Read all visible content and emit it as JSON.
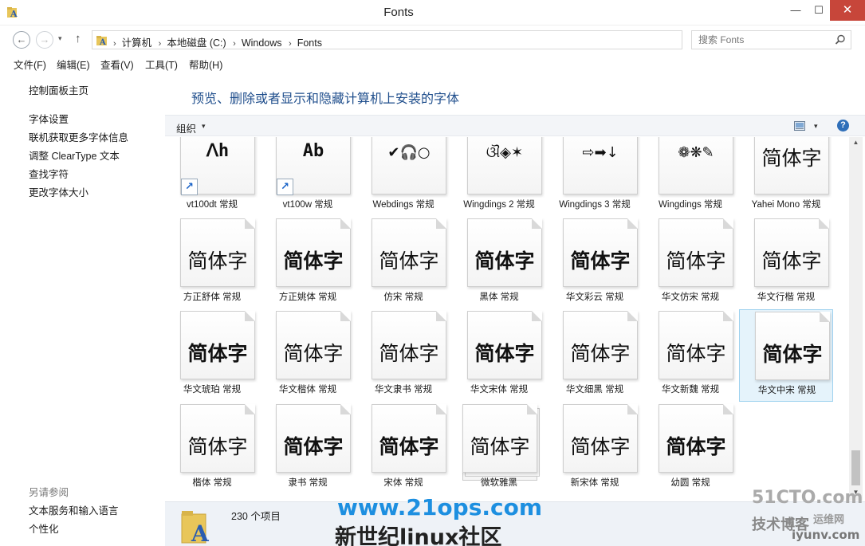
{
  "window": {
    "title": "Fonts",
    "min": "—",
    "max": "☐",
    "close": "✕"
  },
  "nav": {
    "back": "←",
    "forward": "→",
    "up": "↑",
    "dropdown": "▾"
  },
  "address": {
    "crumbs": [
      "计算机",
      "本地磁盘 (C:)",
      "Windows",
      "Fonts"
    ],
    "separator": "›",
    "refresh": "↻",
    "dropdown": "▾"
  },
  "search": {
    "placeholder": "搜索 Fonts",
    "icon": "search-icon"
  },
  "menu": [
    "文件(F)",
    "编辑(E)",
    "查看(V)",
    "工具(T)",
    "帮助(H)"
  ],
  "sidebar": {
    "home": "控制面板主页",
    "links": [
      "字体设置",
      "联机获取更多字体信息",
      "调整 ClearType 文本",
      "查找字符",
      "更改字体大小"
    ],
    "see_also_title": "另请参阅",
    "see_also": [
      "文本服务和输入语言",
      "个性化"
    ]
  },
  "main": {
    "heading": "预览、删除或者显示和隐藏计算机上安装的字体",
    "organize": "组织",
    "dropdown": "▾",
    "help": "?",
    "view_icon": "change-view-icon"
  },
  "fonts": [
    {
      "label": "vt100dt 常规",
      "sample": "ᐱh",
      "shortcut": true
    },
    {
      "label": "vt100w 常规",
      "sample": "Ab",
      "shortcut": true
    },
    {
      "label": "Webdings 常规",
      "sample": "✔🎧○"
    },
    {
      "label": "Wingdings 2 常规",
      "sample": "ଔ◈✶"
    },
    {
      "label": "Wingdings 3 常规",
      "sample": "⇨➡↓"
    },
    {
      "label": "Wingdings 常规",
      "sample": "❁❋✎"
    },
    {
      "label": "Yahei Mono 常规",
      "sample": "简体字"
    },
    {
      "label": "方正舒体 常规",
      "sample": "简体字"
    },
    {
      "label": "方正姚体 常规",
      "sample": "简体字"
    },
    {
      "label": "仿宋 常规",
      "sample": "简体字"
    },
    {
      "label": "黑体 常规",
      "sample": "简体字"
    },
    {
      "label": "华文彩云 常规",
      "sample": "简体字"
    },
    {
      "label": "华文仿宋 常规",
      "sample": "简体字"
    },
    {
      "label": "华文行楷 常规",
      "sample": "简体字"
    },
    {
      "label": "华文琥珀 常规",
      "sample": "简体字"
    },
    {
      "label": "华文楷体 常规",
      "sample": "简体字"
    },
    {
      "label": "华文隶书 常规",
      "sample": "简体字"
    },
    {
      "label": "华文宋体 常规",
      "sample": "简体字"
    },
    {
      "label": "华文细黑 常规",
      "sample": "简体字"
    },
    {
      "label": "华文新魏 常规",
      "sample": "简体字"
    },
    {
      "label": "华文中宋 常规",
      "sample": "简体字",
      "selected": true
    },
    {
      "label": "楷体 常规",
      "sample": "简体字"
    },
    {
      "label": "隶书 常规",
      "sample": "简体字"
    },
    {
      "label": "宋体 常规",
      "sample": "简体字"
    },
    {
      "label": "微软雅黑",
      "sample": "简体字",
      "stack": true
    },
    {
      "label": "新宋体 常规",
      "sample": "简体字"
    },
    {
      "label": "幼圆 常规",
      "sample": "简体字"
    }
  ],
  "status": {
    "count": "230 个项目"
  },
  "watermark": {
    "site": "www.21ops.com",
    "slogan": "新世纪linux社区",
    "brand": "51CTO.com",
    "blog": "技术博客",
    "ops": "运维网",
    "url": "iyunv.com"
  }
}
